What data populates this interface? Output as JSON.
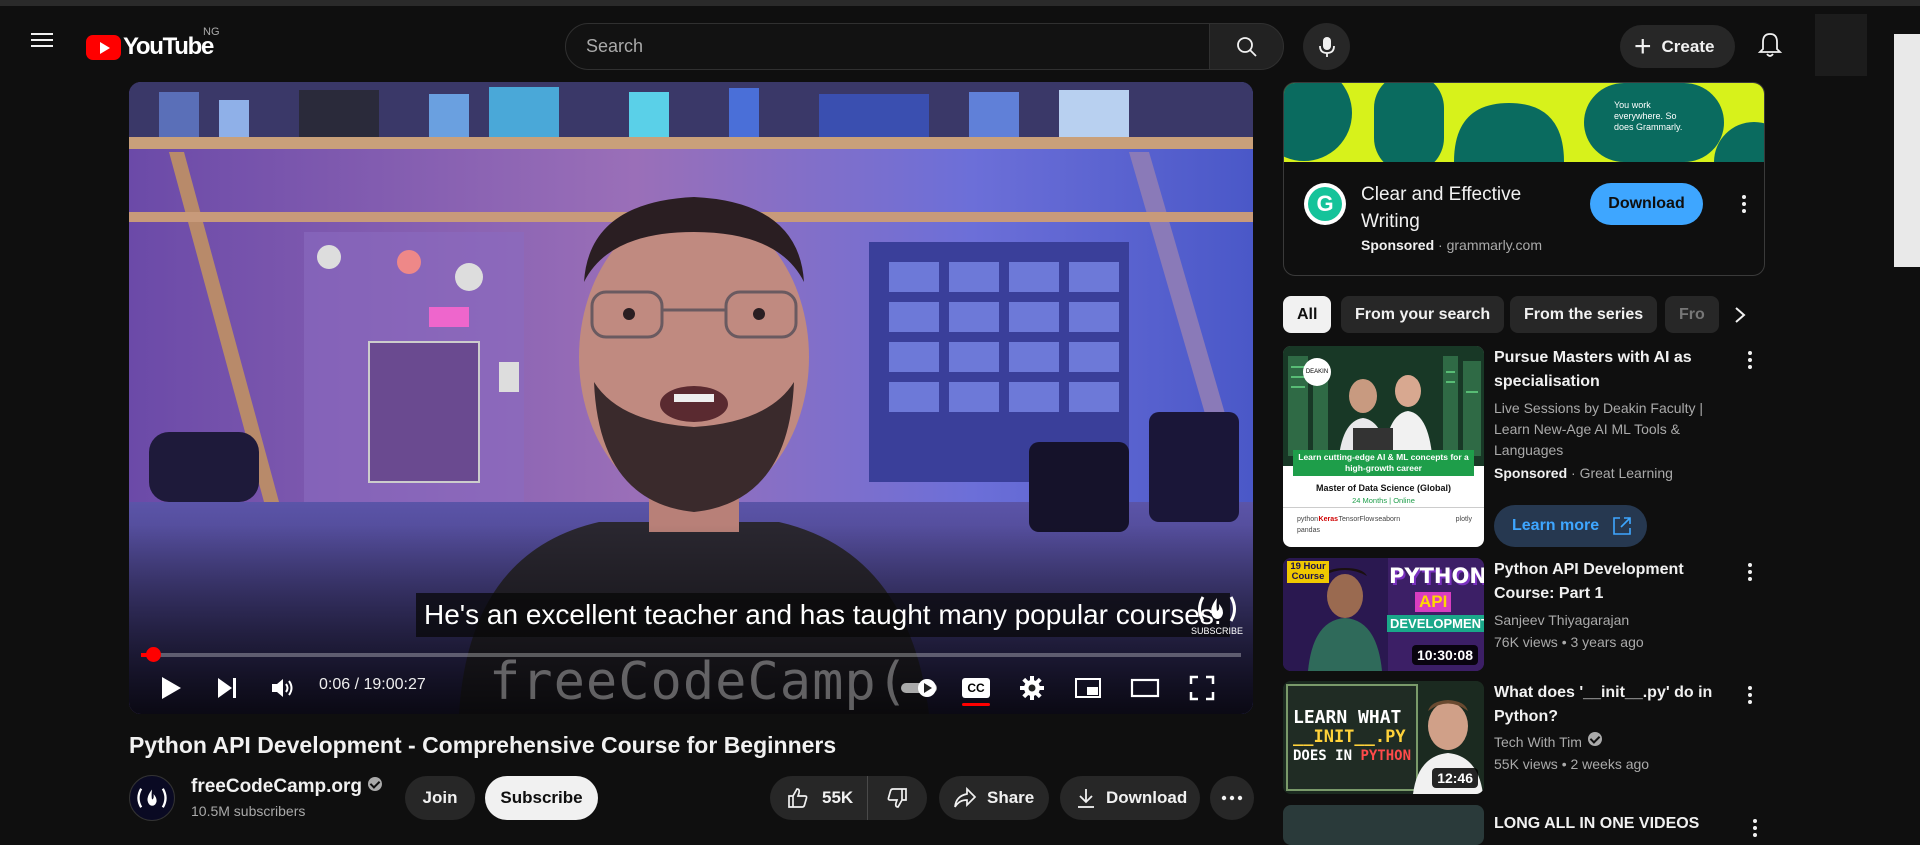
{
  "header": {
    "logo_text": "YouTube",
    "region": "NG",
    "search_placeholder": "Search",
    "create_label": "Create"
  },
  "player": {
    "caption": "He's an excellent teacher and has taught many popular courses.",
    "watermark_label": "SUBSCRIBE",
    "overlay_brand": "freeCodeCamp(",
    "time": "0:06 / 19:00:27",
    "progress_fraction": 0.005,
    "cc_label": "CC"
  },
  "video": {
    "title": "Python API Development - Comprehensive Course for Beginners",
    "channel_name": "freeCodeCamp.org",
    "subscribers": "10.5M subscribers",
    "join_label": "Join",
    "subscribe_label": "Subscribe",
    "likes": "55K",
    "share_label": "Share",
    "download_label": "Download"
  },
  "ad": {
    "banner_text": "You work everywhere. So does Grammarly.",
    "logo_letter": "G",
    "title": "Clear and Effective Writing",
    "sponsored": "Sponsored",
    "domain": "grammarly.com",
    "button_label": "Download"
  },
  "chips": [
    "All",
    "From your search",
    "From the series",
    "Fro"
  ],
  "recommendations": [
    {
      "title": "Pursue Masters with AI as specialisation",
      "description": "Live Sessions by Deakin Faculty | Learn New-Age AI ML Tools & Languages",
      "sponsored": "Sponsored",
      "advertiser": "Great Learning",
      "cta": "Learn more",
      "thumb_logo": "DEAKIN",
      "thumb_banner": "Learn cutting-edge AI & ML concepts for a high-growth career",
      "thumb_program": "Master of Data Science (Global)",
      "thumb_sub": "24 Months | Online",
      "thumb_tools": [
        "python",
        "Keras",
        "TensorFlow",
        "seaborn",
        "plotly",
        "pandas"
      ]
    },
    {
      "title": "Python API Development Course: Part 1",
      "channel": "Sanjeev Thiyagarajan",
      "meta": "76K views • 3 years ago",
      "duration": "10:30:08",
      "thumb_tag": "19 Hour Course",
      "thumb_text1": "PYTHON",
      "thumb_text2": "API",
      "thumb_text3": "DEVELOPMENT"
    },
    {
      "title": "What does '__init__.py' do in Python?",
      "channel": "Tech With Tim",
      "meta": "55K views • 2 weeks ago",
      "duration": "12:46",
      "thumb_line1": "LEARN WHAT",
      "thumb_line2": "__INIT__.PY",
      "thumb_line3a": "DOES IN ",
      "thumb_line3b": "PYTHON"
    },
    {
      "title": "LONG ALL IN ONE VIDEOS"
    }
  ]
}
